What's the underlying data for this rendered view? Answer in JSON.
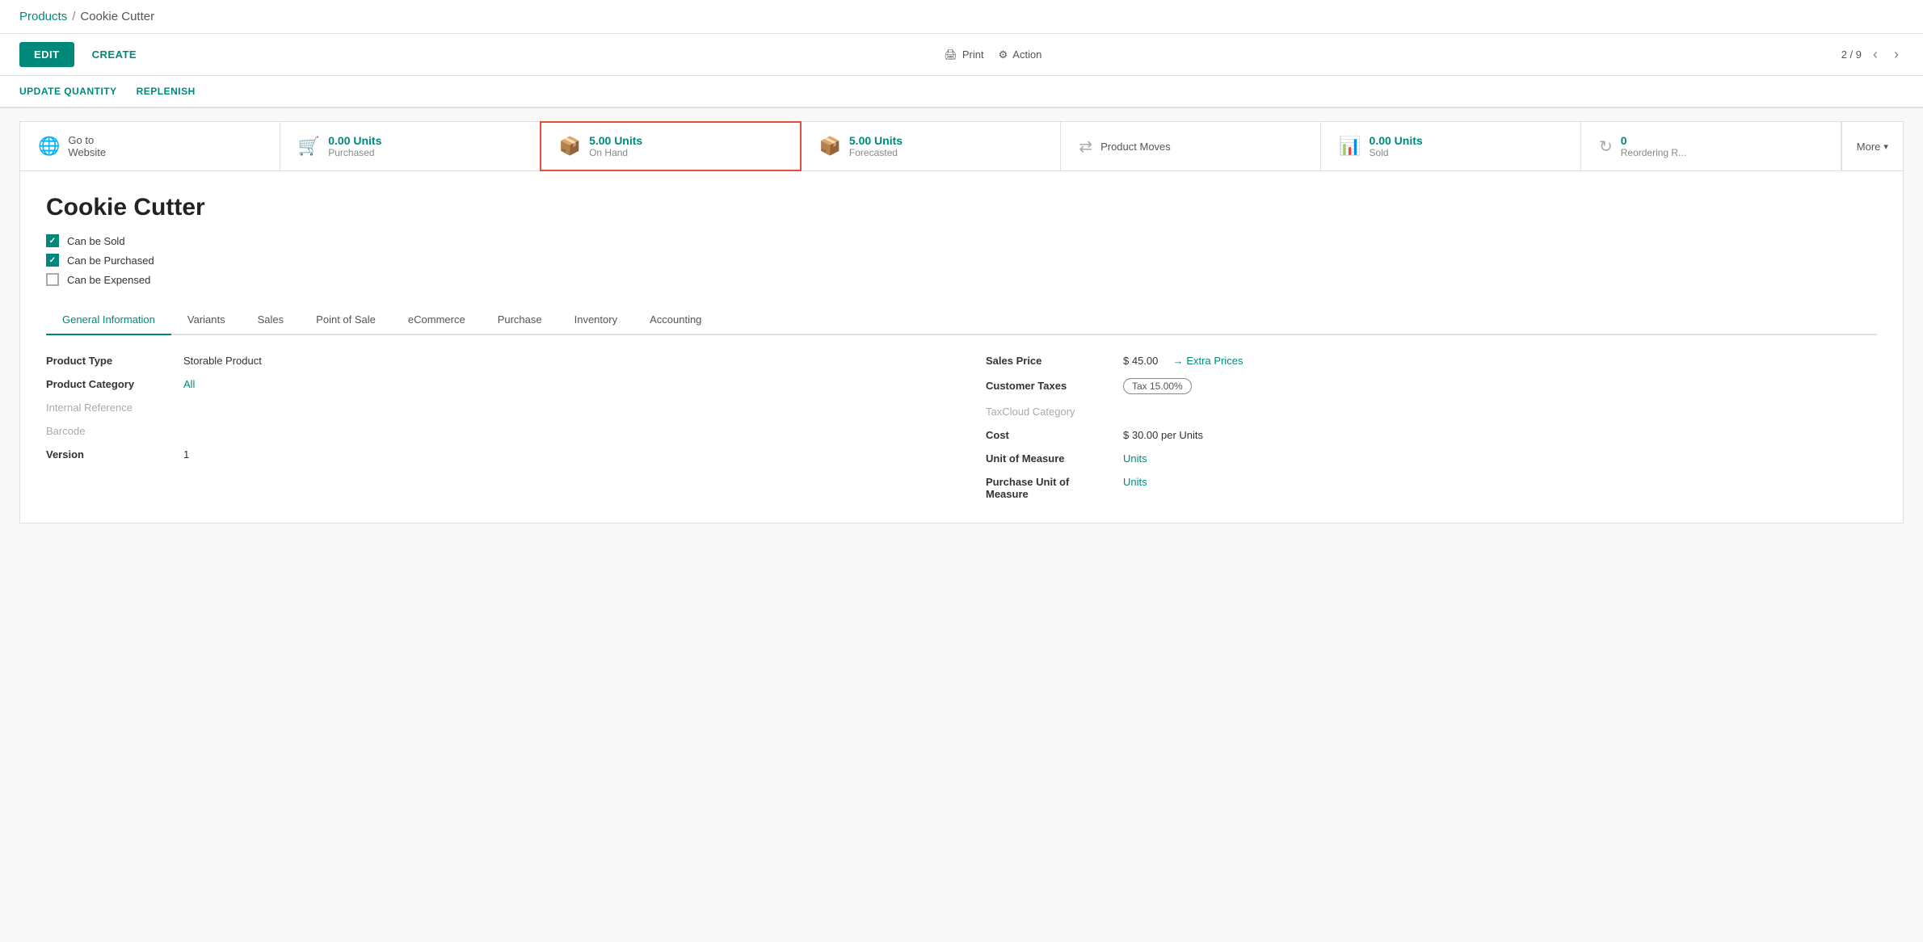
{
  "breadcrumb": {
    "parent_label": "Products",
    "separator": "/",
    "current_label": "Cookie Cutter"
  },
  "toolbar": {
    "edit_label": "EDIT",
    "create_label": "CREATE",
    "print_label": "Print",
    "action_label": "Action",
    "pagination": "2 / 9"
  },
  "action_bar": {
    "update_quantity_label": "UPDATE QUANTITY",
    "replenish_label": "REPLENISH"
  },
  "stats": [
    {
      "id": "website",
      "icon": "globe",
      "value": "",
      "label": "Go to\nWebsite",
      "active": false,
      "teal": false
    },
    {
      "id": "purchased",
      "icon": "cart",
      "value": "0.00 Units",
      "label": "Purchased",
      "active": false,
      "teal": true
    },
    {
      "id": "on_hand",
      "icon": "boxes",
      "value": "5.00 Units",
      "label": "On Hand",
      "active": true,
      "teal": true
    },
    {
      "id": "forecasted",
      "icon": "boxes",
      "value": "5.00 Units",
      "label": "Forecasted",
      "active": false,
      "teal": true
    },
    {
      "id": "product_moves",
      "icon": "transfer",
      "value": "",
      "label": "Product Moves",
      "active": false,
      "teal": false
    },
    {
      "id": "sold",
      "icon": "chart",
      "value": "0.00 Units",
      "label": "Sold",
      "active": false,
      "teal": true
    },
    {
      "id": "reordering",
      "icon": "refresh",
      "value": "0",
      "label": "Reordering R...",
      "active": false,
      "teal": true
    },
    {
      "id": "more",
      "icon": "chevron",
      "value": "",
      "label": "More",
      "active": false,
      "teal": false
    }
  ],
  "product": {
    "title": "Cookie Cutter",
    "can_be_sold": true,
    "can_be_purchased": true,
    "can_be_expensed": false
  },
  "checkboxes": [
    {
      "id": "can_be_sold",
      "label": "Can be Sold",
      "checked": true
    },
    {
      "id": "can_be_purchased",
      "label": "Can be Purchased",
      "checked": true
    },
    {
      "id": "can_be_expensed",
      "label": "Can be Expensed",
      "checked": false
    }
  ],
  "tabs": [
    {
      "id": "general",
      "label": "General Information",
      "active": true
    },
    {
      "id": "variants",
      "label": "Variants",
      "active": false
    },
    {
      "id": "sales",
      "label": "Sales",
      "active": false
    },
    {
      "id": "pos",
      "label": "Point of Sale",
      "active": false
    },
    {
      "id": "ecommerce",
      "label": "eCommerce",
      "active": false
    },
    {
      "id": "purchase",
      "label": "Purchase",
      "active": false
    },
    {
      "id": "inventory",
      "label": "Inventory",
      "active": false
    },
    {
      "id": "accounting",
      "label": "Accounting",
      "active": false
    }
  ],
  "form": {
    "left": {
      "product_type_label": "Product Type",
      "product_type_value": "Storable Product",
      "product_category_label": "Product Category",
      "product_category_value": "All",
      "internal_reference_label": "Internal Reference",
      "barcode_label": "Barcode",
      "version_label": "Version",
      "version_value": "1"
    },
    "right": {
      "sales_price_label": "Sales Price",
      "sales_price_value": "$ 45.00",
      "extra_prices_label": "Extra Prices",
      "customer_taxes_label": "Customer Taxes",
      "tax_badge": "Tax 15.00%",
      "taxcloud_label": "TaxCloud Category",
      "cost_label": "Cost",
      "cost_value": "$ 30.00 per Units",
      "unit_of_measure_label": "Unit of Measure",
      "unit_of_measure_value": "Units",
      "purchase_unit_label": "Purchase Unit of Measure",
      "purchase_unit_value": "Units"
    }
  }
}
